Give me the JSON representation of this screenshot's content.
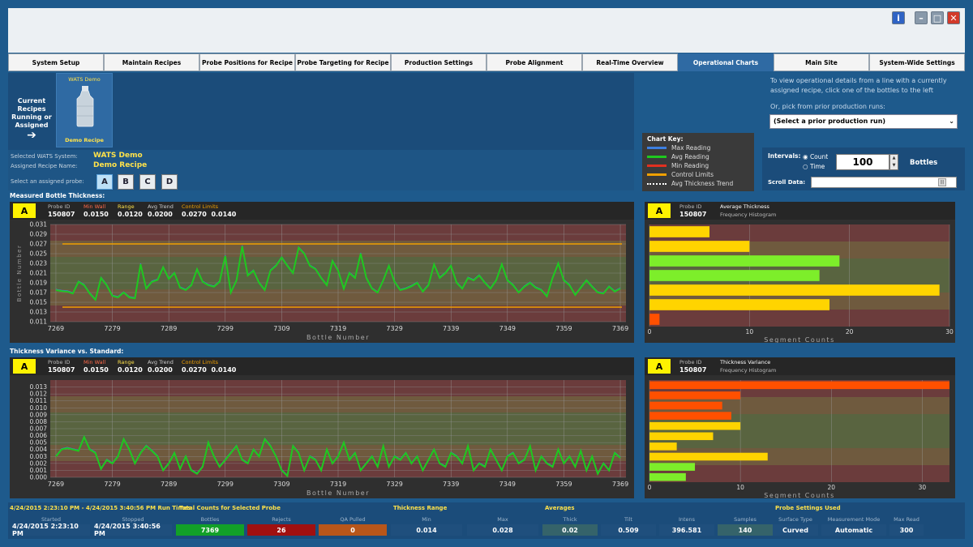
{
  "colors": {
    "accent_yellow": "#ffe24a",
    "badge_yellow": "#fff200",
    "active_tab": "#2f6aa3",
    "max_line": "#3d7fe0",
    "avg_line": "#1fc81f",
    "min_line": "#e23020",
    "control_line": "#f0a000",
    "trend_line": "#ffffff",
    "bottles_bg": "#12a028",
    "rejects_bg": "#a01010",
    "qa_bg": "#b8561a"
  },
  "window": {
    "controls": [
      "info-icon",
      "minimize-icon",
      "maximize-icon",
      "close-icon"
    ]
  },
  "tabs": [
    {
      "label": "System Setup",
      "active": false
    },
    {
      "label": "Maintain Recipes",
      "active": false
    },
    {
      "label": "Probe Positions for Recipe",
      "active": false
    },
    {
      "label": "Probe Targeting for Recipe",
      "active": false
    },
    {
      "label": "Production Settings",
      "active": false
    },
    {
      "label": "Probe Alignment",
      "active": false
    },
    {
      "label": "Real-Time Overview",
      "active": false
    },
    {
      "label": "Operational Charts",
      "active": true
    },
    {
      "label": "Main Site",
      "active": false
    },
    {
      "label": "System-Wide Settings",
      "active": false
    }
  ],
  "current_recipes": {
    "label": "Current Recipes Running or Assigned",
    "card_system": "WATS Demo",
    "card_recipe": "Demo Recipe"
  },
  "selection": {
    "system_label": "Selected WATS System:",
    "system_value": "WATS Demo",
    "recipe_label": "Assigned Recipe Name:",
    "recipe_value": "Demo Recipe",
    "probe_label": "Select an assigned probe:",
    "probes": [
      "A",
      "B",
      "C",
      "D"
    ],
    "selected_probe": "A"
  },
  "chart_key": {
    "title": "Chart Key:",
    "items": [
      {
        "label": "Max Reading",
        "color": "#3d7fe0"
      },
      {
        "label": "Avg Reading",
        "color": "#1fc81f"
      },
      {
        "label": "Min Reading",
        "color": "#e23020"
      },
      {
        "label": "Control Limits",
        "color": "#f0a000"
      },
      {
        "label": "Avg Thickness Trend",
        "color": "#ffffff"
      }
    ]
  },
  "right_controls": {
    "hint1": "To view operational details from a line with a currently assigned recipe, click one of the bottles to the left",
    "hint2": "Or, pick from prior production runs:",
    "prior_select_value": "(Select a prior production run)",
    "intervals_label": "Intervals:",
    "radio_count": "Count",
    "radio_time": "Time",
    "interval_value": "100",
    "bottles_label": "Bottles",
    "scroll_label": "Scroll Data:"
  },
  "sections": {
    "thickness_title": "Measured Bottle Thickness:",
    "variance_title": "Thickness Variance vs. Standard:"
  },
  "panel_header": {
    "badge": "A",
    "probe_id_label": "Probe ID",
    "probe_id": "150807",
    "min_wall_label": "Min Wall",
    "min_wall": "0.0150",
    "range_label": "Range",
    "range": "0.0120",
    "avg_trend_label": "Avg Trend",
    "avg_trend": "0.0200",
    "control_limits_label": "Control Limits",
    "control_low": "0.0270",
    "control_high": "0.0140",
    "hist1_title": "Average Thickness",
    "hist1_sub": "Frequency Histogram",
    "hist2_title": "Thickness Variance",
    "hist2_sub": "Frequency Histogram"
  },
  "chart_data": [
    {
      "type": "line",
      "xlabel": "Bottle Number",
      "ylabel": "Bottle Number",
      "xlim": [
        7268,
        7370
      ],
      "ylim": [
        0.011,
        0.031
      ],
      "x_ticks": [
        7269,
        7279,
        7289,
        7299,
        7309,
        7319,
        7329,
        7339,
        7349,
        7359,
        7369
      ],
      "y_ticks": [
        0.011,
        0.013,
        0.015,
        0.017,
        0.019,
        0.021,
        0.023,
        0.025,
        0.027,
        0.029,
        0.031
      ],
      "control_limits": [
        0.027,
        0.014
      ],
      "x_start": 7269,
      "series": [
        {
          "name": "Avg Reading",
          "values": [
            0.0175,
            0.0173,
            0.0172,
            0.0168,
            0.0192,
            0.0185,
            0.0168,
            0.0155,
            0.02,
            0.0185,
            0.0163,
            0.016,
            0.017,
            0.016,
            0.0158,
            0.0228,
            0.0178,
            0.0192,
            0.0196,
            0.0222,
            0.0198,
            0.021,
            0.018,
            0.0175,
            0.0185,
            0.0218,
            0.0192,
            0.0185,
            0.0182,
            0.0192,
            0.0245,
            0.017,
            0.0195,
            0.0265,
            0.0205,
            0.0215,
            0.019,
            0.0175,
            0.0215,
            0.0225,
            0.0242,
            0.0225,
            0.021,
            0.0262,
            0.025,
            0.0225,
            0.0218,
            0.02,
            0.0185,
            0.0235,
            0.0215,
            0.0178,
            0.021,
            0.02,
            0.025,
            0.02,
            0.0178,
            0.017,
            0.0195,
            0.0225,
            0.0192,
            0.0175,
            0.0178,
            0.0183,
            0.019,
            0.0172,
            0.0185,
            0.0228,
            0.02,
            0.021,
            0.0225,
            0.019,
            0.0178,
            0.02,
            0.0195,
            0.0205,
            0.019,
            0.0178,
            0.0195,
            0.0228,
            0.0195,
            0.0185,
            0.017,
            0.0182,
            0.019,
            0.018,
            0.0175,
            0.0162,
            0.02,
            0.023,
            0.0195,
            0.0185,
            0.0165,
            0.018,
            0.0195,
            0.0182,
            0.017,
            0.0168,
            0.0182,
            0.0172,
            0.0178
          ]
        }
      ]
    },
    {
      "type": "line",
      "xlabel": "Bottle Number",
      "ylabel": "",
      "xlim": [
        7268,
        7370
      ],
      "ylim": [
        0.0,
        0.014
      ],
      "x_ticks": [
        7269,
        7279,
        7289,
        7299,
        7309,
        7319,
        7329,
        7339,
        7349,
        7359,
        7369
      ],
      "y_ticks": [
        0.0,
        0.001,
        0.002,
        0.003,
        0.004,
        0.005,
        0.006,
        0.007,
        0.008,
        0.009,
        0.01,
        0.011,
        0.012,
        0.013
      ],
      "x_start": 7269,
      "series": [
        {
          "name": "Avg Reading",
          "values": [
            0.003,
            0.004,
            0.0042,
            0.004,
            0.0038,
            0.0058,
            0.004,
            0.0035,
            0.0012,
            0.0025,
            0.002,
            0.003,
            0.0055,
            0.004,
            0.002,
            0.0035,
            0.0045,
            0.0038,
            0.003,
            0.001,
            0.002,
            0.0035,
            0.0012,
            0.003,
            0.001,
            0.0005,
            0.0015,
            0.005,
            0.003,
            0.0015,
            0.0025,
            0.0035,
            0.0045,
            0.0025,
            0.002,
            0.004,
            0.003,
            0.0055,
            0.0045,
            0.003,
            0.001,
            0.0002,
            0.0045,
            0.0035,
            0.001,
            0.003,
            0.0025,
            0.001,
            0.004,
            0.002,
            0.003,
            0.005,
            0.0025,
            0.0035,
            0.001,
            0.002,
            0.003,
            0.0015,
            0.0045,
            0.0015,
            0.003,
            0.0025,
            0.0035,
            0.002,
            0.003,
            0.001,
            0.0025,
            0.004,
            0.002,
            0.0015,
            0.0035,
            0.003,
            0.002,
            0.0045,
            0.001,
            0.002,
            0.0015,
            0.004,
            0.0025,
            0.001,
            0.003,
            0.0035,
            0.002,
            0.0025,
            0.0045,
            0.001,
            0.003,
            0.002,
            0.0015,
            0.004,
            0.002,
            0.003,
            0.0015,
            0.0038,
            0.001,
            0.003,
            0.0005,
            0.002,
            0.001,
            0.0035,
            0.0028
          ]
        }
      ]
    },
    {
      "type": "bar",
      "orientation": "horizontal",
      "xlabel": "Segment Counts",
      "xlim": [
        0,
        30
      ],
      "x_ticks": [
        0,
        10,
        20,
        30
      ],
      "values": [
        6,
        10,
        19,
        17,
        29,
        18,
        1
      ],
      "colors": [
        "#ffd400",
        "#ffd400",
        "#7dee2a",
        "#7dee2a",
        "#ffd400",
        "#ffd400",
        "#ff5000"
      ]
    },
    {
      "type": "bar",
      "orientation": "horizontal",
      "xlabel": "Segment Counts",
      "xlim": [
        0,
        33
      ],
      "x_ticks": [
        0,
        10,
        20,
        30
      ],
      "values": [
        33,
        10,
        8,
        9,
        10,
        7,
        3,
        13,
        5,
        4
      ],
      "colors": [
        "#ff5000",
        "#ff5000",
        "#ff5000",
        "#ff5000",
        "#ffd400",
        "#ffd400",
        "#ffd400",
        "#ffd400",
        "#7dee2a",
        "#7dee2a"
      ]
    }
  ],
  "footer": {
    "run_times_title": "4/24/2015 2:23:10 PM - 4/24/2015 3:40:56 PM Run Times",
    "started_label": "Started",
    "started": "4/24/2015 2:23:10 PM",
    "stopped_label": "Stopped",
    "stopped": "4/24/2015 3:40:56 PM",
    "counts_title": "Total Counts for Selected Probe",
    "bottles_label": "Bottles",
    "bottles": "7369",
    "rejects_label": "Rejects",
    "rejects": "26",
    "qa_label": "QA Pulled",
    "qa": "0",
    "range_title": "Thickness Range",
    "min_label": "Min",
    "min": "0.014",
    "max_label": "Max",
    "max": "0.028",
    "averages_title": "Averages",
    "thick_label": "Thick",
    "thick": "0.02",
    "tilt_label": "Tilt",
    "tilt": "0.509",
    "intens_label": "Intens",
    "intens": "396.581",
    "samples_label": "Samples",
    "samples": "140",
    "probe_settings_title": "Probe Settings Used",
    "surface_label": "Surface Type",
    "surface": "Curved",
    "mode_label": "Measurement Mode",
    "mode": "Automatic",
    "maxread_label": "Max Read",
    "maxread": "300"
  }
}
